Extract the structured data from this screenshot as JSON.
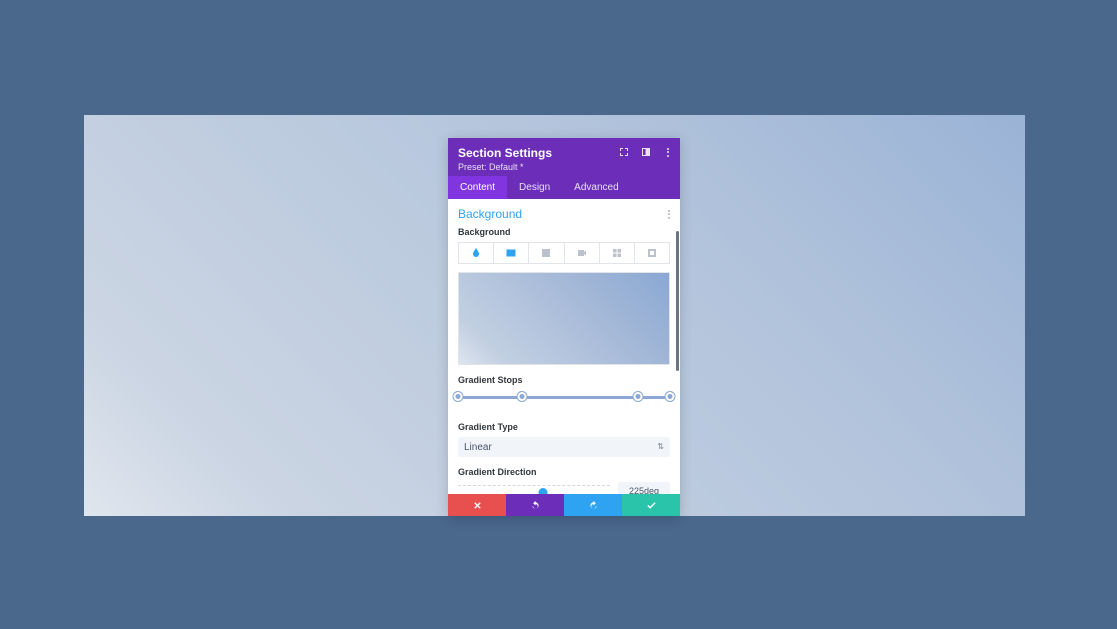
{
  "header": {
    "title": "Section Settings",
    "preset_line": "Preset: Default *"
  },
  "tabs": {
    "content": "Content",
    "design": "Design",
    "advanced": "Advanced",
    "active": "content"
  },
  "body": {
    "section_title": "Background",
    "field_background": "Background",
    "bg_type_tabs": [
      "color",
      "gradient",
      "image",
      "video",
      "pattern",
      "mask"
    ],
    "bg_type_active": "gradient",
    "gradient_stops_label": "Gradient Stops",
    "gradient_stops_positions": [
      0,
      30,
      85,
      100
    ],
    "gradient_type_label": "Gradient Type",
    "gradient_type_value": "Linear",
    "gradient_direction_label": "Gradient Direction",
    "gradient_direction_value": "225deg",
    "gradient_direction_pct": 56
  },
  "colors": {
    "accent_purple": "#6c2eb9",
    "accent_blue": "#2ea3f2",
    "accent_green": "#29c4a9",
    "accent_red": "#e84f4f",
    "slider": "#8aa8d3"
  }
}
